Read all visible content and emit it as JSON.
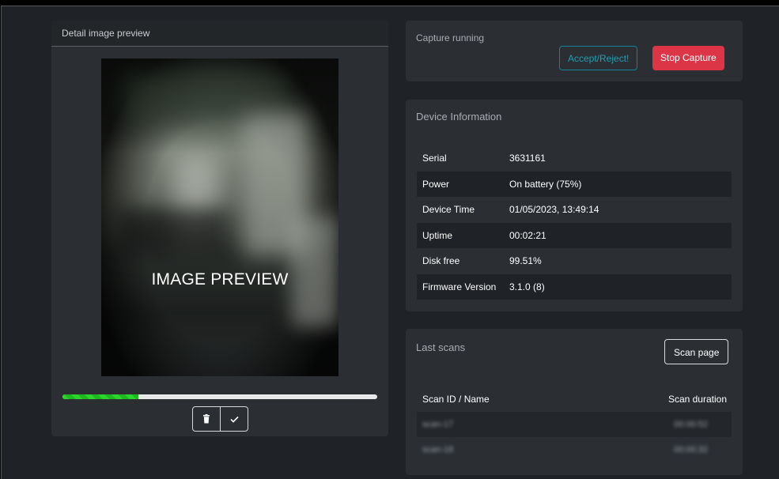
{
  "preview": {
    "header": "Detail image preview",
    "image_label": "IMAGE PREVIEW",
    "progress_fraction": 0.24,
    "delete_icon": "trash-icon",
    "accept_icon": "check-icon"
  },
  "capture": {
    "status": "Capture running",
    "accept_reject_label": "Accept/Reject!",
    "stop_label": "Stop Capture"
  },
  "device": {
    "title": "Device Information",
    "rows": [
      {
        "key": "Serial",
        "value": "3631161"
      },
      {
        "key": "Power",
        "value": "On battery (75%)"
      },
      {
        "key": "Device Time",
        "value": "01/05/2023, 13:49:14"
      },
      {
        "key": "Uptime",
        "value": "00:02:21"
      },
      {
        "key": "Disk free",
        "value": "99.51%"
      },
      {
        "key": "Firmware Version",
        "value": "3.1.0 (8)"
      }
    ]
  },
  "scans": {
    "title": "Last scans",
    "scan_page_label": "Scan page",
    "columns": [
      "Scan ID / Name",
      "Scan duration"
    ],
    "rows": [
      {
        "name": "scan-17",
        "duration": "00:00:52"
      },
      {
        "name": "scan-18",
        "duration": "00:00:32"
      }
    ]
  },
  "colors": {
    "accent_info": "#17a2b8",
    "danger": "#dc3545",
    "progress": "#2bd62b"
  }
}
